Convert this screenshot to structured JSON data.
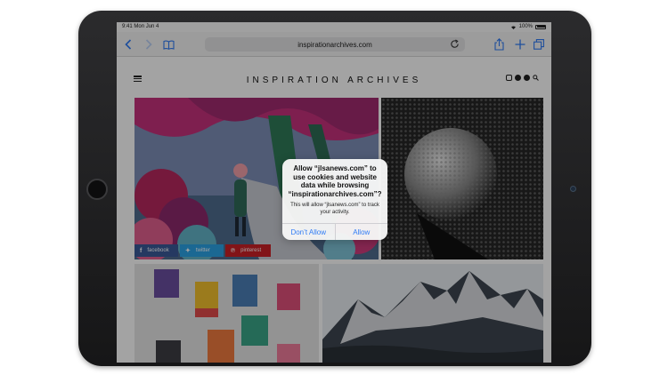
{
  "status": {
    "time": "9:41",
    "date": "Mon Jun 4",
    "battery": "100%"
  },
  "browser": {
    "url": "inspirationarchives.com",
    "icons": [
      "back-icon",
      "forward-icon",
      "bookmarks-icon",
      "reload-icon",
      "share-icon",
      "add-icon",
      "tabs-icon"
    ]
  },
  "site": {
    "title": "INSPIRATION ARCHIVES",
    "social_icons": [
      "instagram-icon",
      "twitter-icon",
      "pinterest-icon",
      "search-icon"
    ]
  },
  "share": {
    "facebook": "facebook",
    "twitter": "twitter",
    "pinterest": "pinterest"
  },
  "alert": {
    "title": "Allow “jlsanews.com” to use cookies and website data while browsing “inspirationarchives.com”?",
    "message": "This will allow “jlsanews.com” to track your activity.",
    "deny": "Don’t Allow",
    "allow": "Allow"
  },
  "colors": {
    "accent": "#2f7bf5",
    "facebook": "#3b5a98",
    "twitter": "#2ba3e6",
    "pinterest": "#cb2027"
  }
}
